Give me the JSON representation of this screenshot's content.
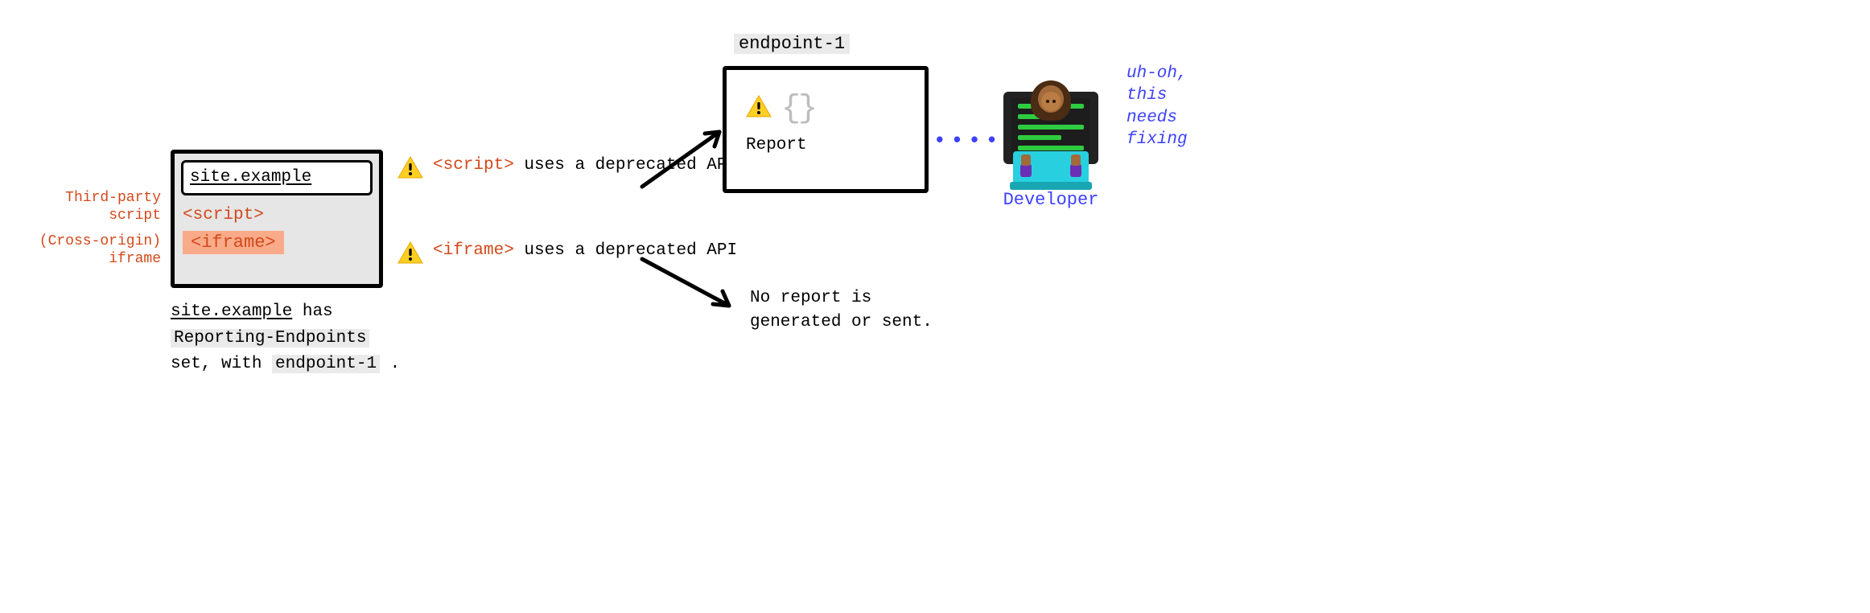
{
  "left_labels": {
    "script": "Third-party\nscript",
    "iframe": "(Cross-origin)\niframe"
  },
  "site_box": {
    "url": "site.example",
    "script_tag": "<script>",
    "iframe_tag": "<iframe>"
  },
  "caption": {
    "site": "site.example",
    "line1_rest": " has ",
    "header": "Reporting-Endpoints",
    "line2_prefix": "set, with ",
    "endpoint": "endpoint-1",
    "line2_suffix": " ."
  },
  "warnings": {
    "script": {
      "tag": "<script>",
      "rest": " uses a deprecated API"
    },
    "iframe": {
      "tag": "<iframe>",
      "rest": " uses a deprecated API"
    }
  },
  "endpoint": {
    "name": "endpoint-1"
  },
  "report_box": {
    "label": "Report",
    "braces": "{}"
  },
  "no_report": "No report is generated or sent.",
  "developer": {
    "label": "Developer",
    "speech": "uh-oh,\nthis\nneeds\nfixing",
    "dots": "••••••"
  },
  "icons": {
    "warning": "warning-icon",
    "curly": "curly-braces-icon"
  },
  "colors": {
    "orange": "#d2491b",
    "blue": "#3e41ff",
    "grey": "#eaeaea",
    "salmon": "#f9aa89"
  }
}
